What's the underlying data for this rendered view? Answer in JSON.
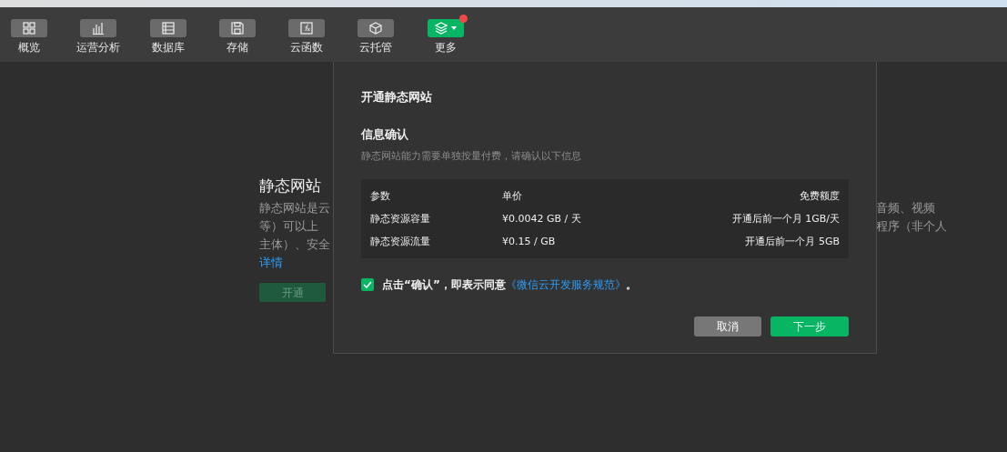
{
  "toolbar": [
    {
      "label": "概览",
      "selected": false,
      "badge": false
    },
    {
      "label": "运营分析",
      "selected": false,
      "badge": false
    },
    {
      "label": "数据库",
      "selected": false,
      "badge": false
    },
    {
      "label": "存储",
      "selected": false,
      "badge": false
    },
    {
      "label": "云函数",
      "selected": false,
      "badge": false
    },
    {
      "label": "云托管",
      "selected": false,
      "badge": false
    },
    {
      "label": "更多",
      "selected": true,
      "badge": true
    }
  ],
  "page": {
    "title": "静态网站",
    "description_left": [
      "静态网站是云",
      "等）可以上",
      "主体）、安全"
    ],
    "description_right": [
      "音频、视频",
      "程序（非个人"
    ],
    "link": "详情",
    "button": {
      "label": "开通",
      "disabled": true
    }
  },
  "dialog": {
    "title": "开通静态网站",
    "section_title": "信息确认",
    "section_hint": "静态网站能力需要单独按量付费，请确认以下信息",
    "table": {
      "columns": [
        "参数",
        "单价",
        "免费额度"
      ],
      "rows": [
        [
          "静态资源容量",
          "¥0.0042 GB / 天",
          "开通后前一个月 1GB/天"
        ],
        [
          "静态资源流量",
          "¥0.15 / GB",
          "开通后前一个月 5GB"
        ]
      ]
    },
    "agreement": {
      "checked": true,
      "text": "点击“确认”，即表示同意",
      "link": "《微信云开发服务规范》",
      "suffix": "。"
    },
    "buttons": [
      {
        "label": "取消",
        "kind": "secondary"
      },
      {
        "label": "下一步",
        "kind": "primary"
      }
    ]
  }
}
